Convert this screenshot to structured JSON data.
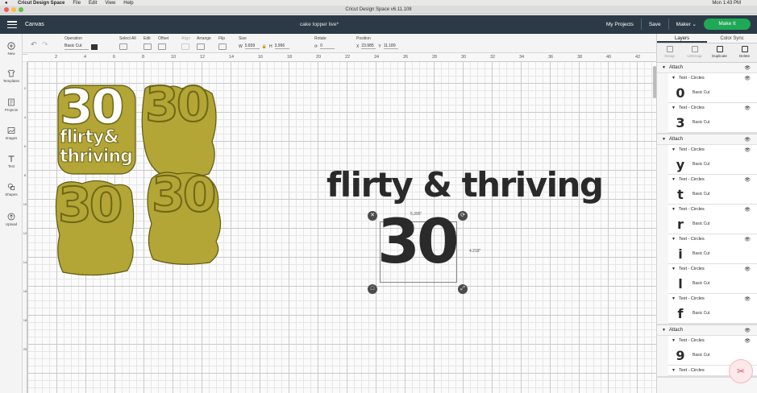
{
  "menubar": {
    "items": [
      "Cricut Design Space",
      "File",
      "Edit",
      "View",
      "Help"
    ],
    "clock": "Mon 1:43 PM"
  },
  "window": {
    "title": "Cricut Design Space  v6.11.108"
  },
  "header": {
    "canvas_label": "Canvas",
    "project_name": "cake topper live*",
    "my_projects": "My Projects",
    "save": "Save",
    "machine": "Maker",
    "make_it": "Make It"
  },
  "toolbar": {
    "operation_label": "Operation",
    "operation_value": "Basic Cut",
    "select_all": "Select All",
    "edit": "Edit",
    "offset": "Offset",
    "align": "Align",
    "arrange": "Arrange",
    "flip": "Flip",
    "size_label": "Size",
    "w_label": "W",
    "w_value": "5.839",
    "h_label": "H",
    "h_value": "3.996",
    "rotate_label": "Rotate",
    "rotate_value": "0",
    "position_label": "Position",
    "x_label": "X",
    "x_value": "23.985",
    "y_label": "Y",
    "y_value": "11.189"
  },
  "sidebar": {
    "items": [
      {
        "label": "New",
        "icon": "plus-circle-icon"
      },
      {
        "label": "Templates",
        "icon": "shirt-icon"
      },
      {
        "label": "Projects",
        "icon": "projects-icon"
      },
      {
        "label": "Images",
        "icon": "image-icon"
      },
      {
        "label": "Text",
        "icon": "text-icon"
      },
      {
        "label": "Shapes",
        "icon": "shapes-icon"
      },
      {
        "label": "Upload",
        "icon": "upload-icon"
      }
    ]
  },
  "ruler": {
    "top": [
      "2",
      "4",
      "6",
      "8",
      "10",
      "12",
      "14",
      "16",
      "18",
      "20",
      "22",
      "24",
      "26",
      "28",
      "30",
      "32",
      "34",
      "36",
      "38",
      "40",
      "42"
    ],
    "left": [
      "2",
      "4",
      "6",
      "8",
      "10",
      "12",
      "14",
      "16",
      "18",
      "20"
    ]
  },
  "canvas": {
    "topper_number": "30",
    "topper_line1": "flirty&",
    "topper_line2": "thriving",
    "phrase": "flirty & thriving",
    "selected_text": "30",
    "width_readout": "5.395\"",
    "height_readout": "4.218\""
  },
  "panel": {
    "tabs": [
      "Layers",
      "Color Sync"
    ],
    "tools": [
      "Group",
      "UnGroup",
      "Duplicate",
      "Delete"
    ],
    "groups": [
      {
        "label": "Attach",
        "layers": [
          {
            "name": "Text - Circles",
            "glyph": "0",
            "cut": "Basic Cut"
          },
          {
            "name": "Text - Circles",
            "glyph": "3",
            "cut": "Basic Cut"
          }
        ]
      },
      {
        "label": "Attach",
        "layers": [
          {
            "name": "Text - Circles",
            "glyph": "y",
            "cut": "Basic Cut"
          },
          {
            "name": "Text - Circles",
            "glyph": "t",
            "cut": "Basic Cut"
          },
          {
            "name": "Text - Circles",
            "glyph": "r",
            "cut": "Basic Cut"
          },
          {
            "name": "Text - Circles",
            "glyph": "i",
            "cut": "Basic Cut"
          },
          {
            "name": "Text - Circles",
            "glyph": "l",
            "cut": "Basic Cut"
          },
          {
            "name": "Text - Circles",
            "glyph": "f",
            "cut": "Basic Cut"
          }
        ]
      },
      {
        "label": "Attach",
        "layers": [
          {
            "name": "Text - Circles",
            "glyph": "9",
            "cut": "Basic Cut"
          },
          {
            "name": "Text - Circles",
            "glyph": "",
            "cut": ""
          }
        ]
      }
    ]
  },
  "colors": {
    "header": "#2b3a46",
    "make_it": "#1fa855",
    "gold": "#b3a536",
    "text_dark": "#2a2a2a"
  }
}
